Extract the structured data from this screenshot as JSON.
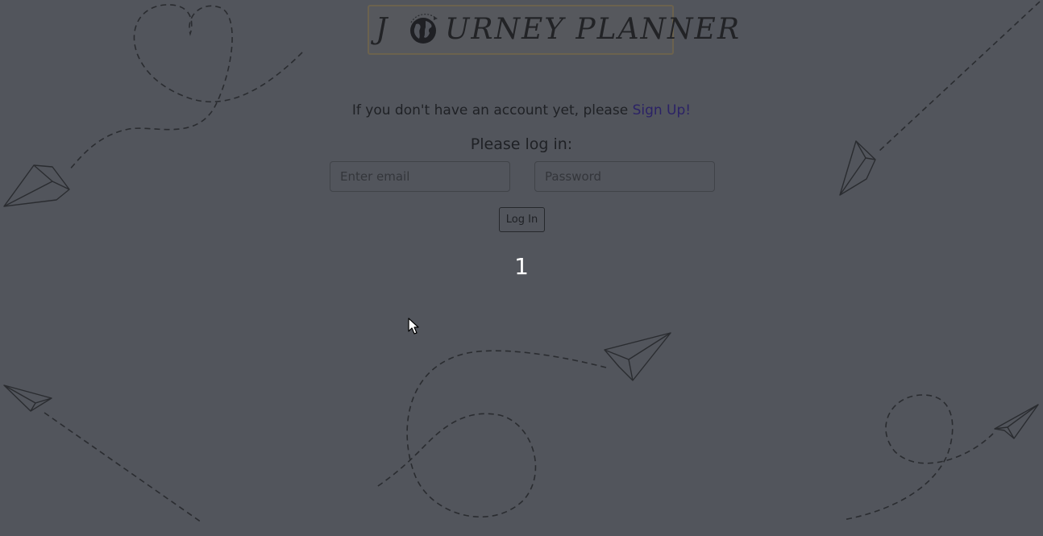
{
  "logo": {
    "first_letter": "J",
    "rest": "URNEY PLANNER",
    "icon": "globe-icon"
  },
  "signup": {
    "prefix": "If you don't have an account yet, please ",
    "link_label": "Sign Up",
    "suffix": "!"
  },
  "login": {
    "heading": "Please log in:",
    "email_placeholder": "Enter email",
    "password_placeholder": "Password",
    "button_label": "Log In"
  },
  "counter": "1",
  "colors": {
    "background": "#52555c",
    "link": "#2b2266",
    "logo_border": "#6b624e"
  },
  "decorations": [
    "paper-plane-icon",
    "dashed-flight-path",
    "heart-flight-path"
  ]
}
